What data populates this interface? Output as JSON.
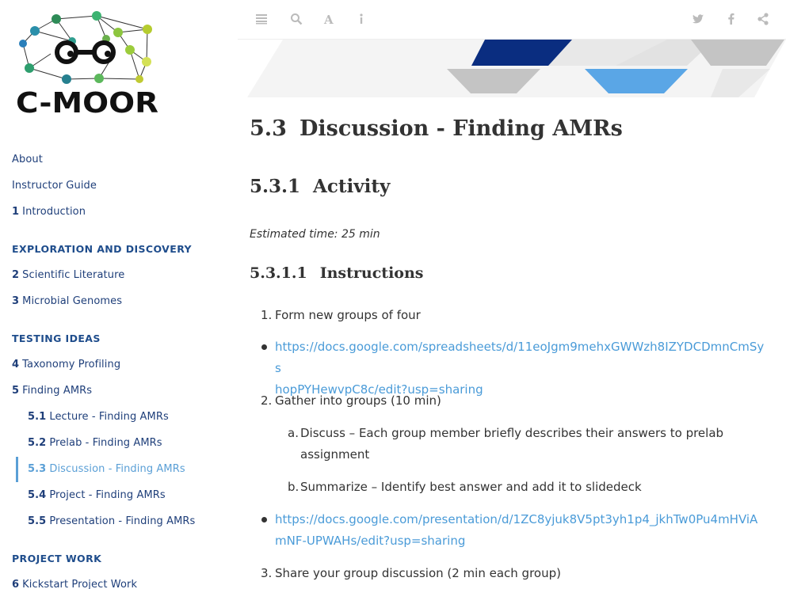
{
  "logo": {
    "text": "C-MOOR"
  },
  "sidebar": {
    "items": [
      {
        "num": "",
        "label": "About"
      },
      {
        "num": "",
        "label": "Instructor Guide"
      },
      {
        "num": "1",
        "label": "Introduction"
      }
    ],
    "section_exploration": "EXPLORATION AND DISCOVERY",
    "exploration_items": [
      {
        "num": "2",
        "label": "Scientific Literature"
      },
      {
        "num": "3",
        "label": "Microbial Genomes"
      }
    ],
    "section_testing": "TESTING IDEAS",
    "testing_items": [
      {
        "num": "4",
        "label": "Taxonomy Profiling"
      },
      {
        "num": "5",
        "label": "Finding AMRs"
      }
    ],
    "sub_items": [
      {
        "num": "5.1",
        "label": "Lecture - Finding AMRs"
      },
      {
        "num": "5.2",
        "label": "Prelab - Finding AMRs"
      },
      {
        "num": "5.3",
        "label": "Discussion - Finding AMRs"
      },
      {
        "num": "5.4",
        "label": "Project - Finding AMRs"
      },
      {
        "num": "5.5",
        "label": "Presentation - Finding AMRs"
      }
    ],
    "section_project": "PROJECT WORK",
    "project_items": [
      {
        "num": "6",
        "label": "Kickstart Project Work"
      }
    ]
  },
  "toolbar": {
    "icons": [
      "menu-icon",
      "search-icon",
      "font-icon",
      "info-icon",
      "twitter-icon",
      "facebook-icon",
      "share-icon"
    ]
  },
  "page": {
    "h1_num": "5.3",
    "h1_text": "Discussion - Finding AMRs",
    "h2_num": "5.3.1",
    "h2_text": "Activity",
    "estimated_time": "Estimated time: 25 min",
    "h3_num": "5.3.1.1",
    "h3_text": "Instructions",
    "list": {
      "item1_marker": "1.",
      "item1": "Form new groups of four",
      "link1": "https://docs.google.com/spreadsheets/d/11eoJgm9mehxGWWzh8IZYDCDmnCmSyshopPYHewvpC8c/edit?usp=sharing",
      "link1_line1": "https://docs.google.com/spreadsheets/d/11eoJgm9mehxGWWzh8IZYDCDmnCmSys",
      "link1_line2": "hopPYHewvpC8c/edit?usp=sharing",
      "item2_marker": "2.",
      "item2": "Gather into groups (10 min)",
      "sub_a_marker": "a.",
      "sub_a_line1": "Discuss – Each group member briefly describes their answers to prelab",
      "sub_a_line2": "assignment",
      "sub_b_marker": "b.",
      "sub_b": "Summarize – Identify best answer and add it to slidedeck",
      "link2": "https://docs.google.com/presentation/d/1ZC8yjuk8V5pt3yh1p4_jkhTw0Pu4mHViAmNF-UPWAHs/edit?usp=sharing",
      "link2_line1": "https://docs.google.com/presentation/d/1ZC8yjuk8V5pt3yh1p4_jkhTw0Pu4mHViA",
      "link2_line2": "mNF-UPWAHs/edit?usp=sharing",
      "item3_marker": "3.",
      "item3": "Share your group discussion (2 min each group)"
    }
  },
  "colors": {
    "nav_link": "#1f3f7a",
    "active": "#5a9fd6",
    "link": "#4a9bd8",
    "banner_dark": "#0a2d80",
    "banner_light": "#5aa6e6"
  }
}
